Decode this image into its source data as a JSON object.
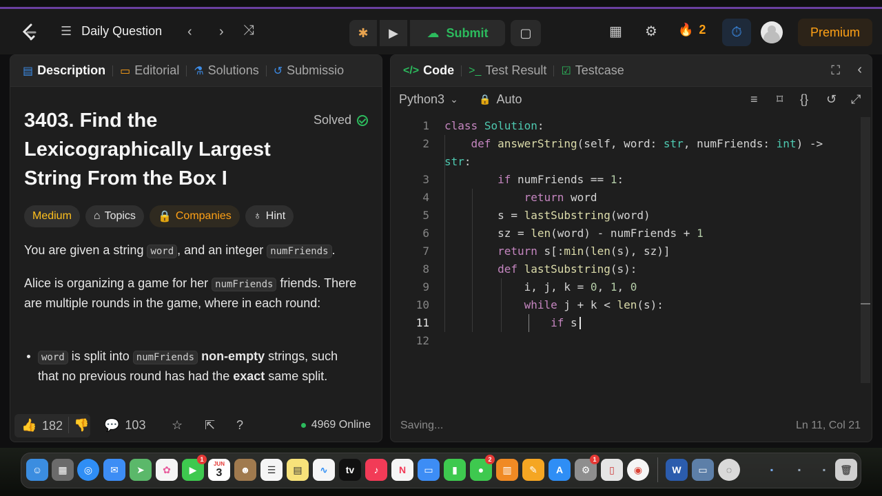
{
  "header": {
    "problem_list_label": "Daily Question",
    "submit_label": "Submit",
    "streak_count": "2",
    "premium_label": "Premium"
  },
  "left_panel": {
    "tabs": [
      {
        "label": "Description"
      },
      {
        "label": "Editorial"
      },
      {
        "label": "Solutions"
      },
      {
        "label": "Submissio"
      }
    ],
    "title": "3403. Find the Lexicographically Largest String From the Box I",
    "solved_label": "Solved",
    "chips": {
      "difficulty": "Medium",
      "topics": "Topics",
      "companies": "Companies",
      "hint": "Hint"
    },
    "p1": {
      "a": "You are given a string ",
      "code1": "word",
      "b": ", and an integer ",
      "code2": "numFriends",
      "c": "."
    },
    "p2": {
      "a": "Alice is organizing a game for her ",
      "code1": "numFriends",
      "b": " friends. There are multiple rounds in the game, where in each round:"
    },
    "bullet1": {
      "code1": "word",
      "a": " is split into ",
      "code2": "numFriends",
      "b": " ",
      "bold1": "non-empty",
      "c": " strings, such that no previous round has had the ",
      "bold2": "exact",
      "d": " same split."
    },
    "footer": {
      "likes": "182",
      "comments": "103",
      "online": "4969 Online"
    }
  },
  "right_panel": {
    "tabs": [
      {
        "label": "Code"
      },
      {
        "label": "Test Result"
      },
      {
        "label": "Testcase"
      }
    ],
    "language": "Python3",
    "autocomplete": "Auto",
    "code_lines": [
      "class Solution:",
      "    def answerString(self, word: str, numFriends: int) ->",
      "str:",
      "        if numFriends == 1:",
      "            return word",
      "        s = lastSubstring(word)",
      "        sz = len(word) - numFriends + 1",
      "        return s[:min(len(s), sz)]",
      "        def lastSubstring(s):",
      "            i, j, k = 0, 1, 0",
      "            while j + k < len(s):",
      "                if s",
      ""
    ],
    "line_numbers": [
      "1",
      "2",
      "",
      "3",
      "4",
      "5",
      "6",
      "7",
      "8",
      "9",
      "10",
      "11",
      "12"
    ],
    "status_left": "Saving...",
    "status_right": "Ln 11, Col 21"
  },
  "colors": {
    "accent": "#ffa116",
    "submit_green": "#2cbb5d",
    "medium_yellow": "#ffc01e",
    "timer_blue": "#3c8ce7"
  },
  "dock": {
    "calendar_month": "JUN",
    "calendar_day": "3",
    "badges": [
      "1",
      "2",
      "1"
    ]
  }
}
